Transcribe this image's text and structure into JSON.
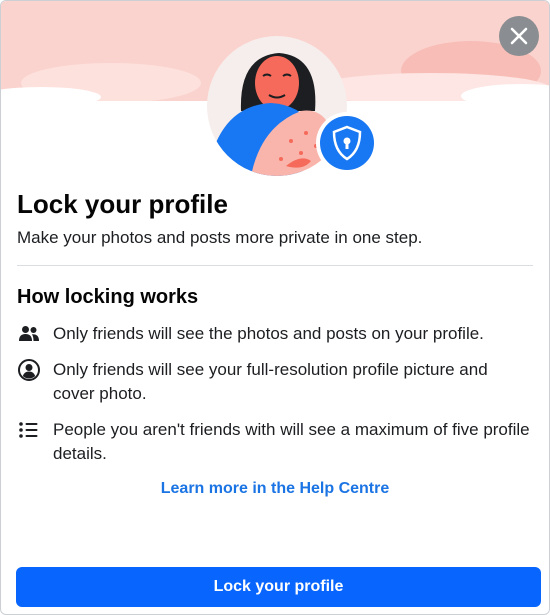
{
  "dialog": {
    "title": "Lock your profile",
    "subtitle": "Make your photos and posts more private in one step.",
    "section_title": "How locking works",
    "items": [
      {
        "icon": "friends-icon",
        "text": "Only friends will see the photos and posts on your profile."
      },
      {
        "icon": "profile-circle-icon",
        "text": "Only friends will see your full-resolution profile picture and cover photo."
      },
      {
        "icon": "list-icon",
        "text": "People you aren't friends with will see a maximum of five profile details."
      }
    ],
    "learn_more_label": "Learn more in the Help Centre",
    "lock_button_label": "Lock your profile"
  },
  "colors": {
    "accent": "#0866ff",
    "link": "#1b74e4",
    "banner_pink": "#fbd0cc",
    "shield": "#1877f2"
  }
}
